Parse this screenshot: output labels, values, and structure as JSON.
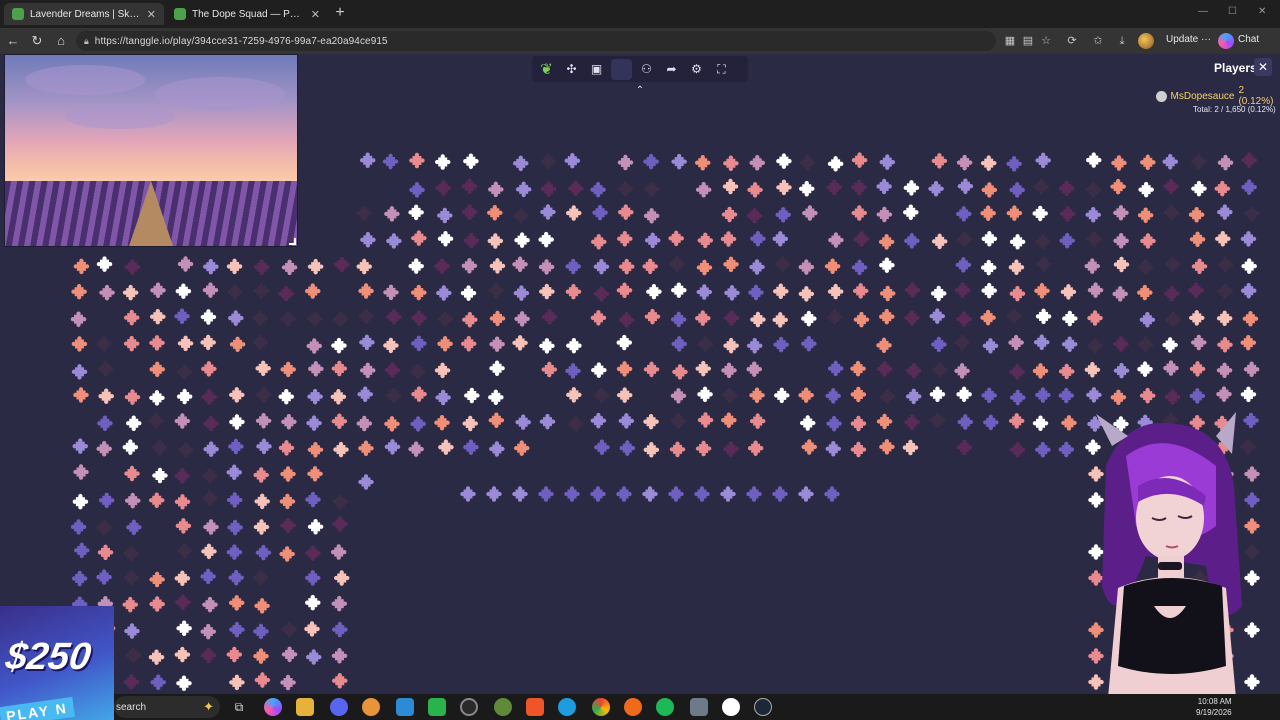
{
  "browser": {
    "tabs": [
      {
        "title": "Lavender Dreams | Sky Jigsaw",
        "active": true
      },
      {
        "title": "The Dope Squad — Puzzles",
        "active": false
      }
    ],
    "new_tab": "+",
    "url": "https://tanggle.io/play/394cce31-7259-4976-99a7-ea20a94ce915",
    "update_label": "Update ···",
    "chat_label": "Chat"
  },
  "game": {
    "players_title": "Players",
    "player": {
      "name": "MsDopesauce",
      "score": "2 (0.12%)"
    },
    "total": "Total: 2 / 1,650 (0.12%)",
    "colors": {
      "background": "#2b2a45",
      "pieces": [
        "#f08f78",
        "#f7c2b8",
        "#ffffff",
        "#9a8ad8",
        "#6f5fc0",
        "#c490b8",
        "#3b2e46",
        "#5a2a58",
        "#e88a8e"
      ]
    }
  },
  "promo": {
    "amount": "$250",
    "play": "PLAY N"
  },
  "taskbar": {
    "search": "search",
    "time": "10:08 AM",
    "date": "9/19/2026"
  }
}
